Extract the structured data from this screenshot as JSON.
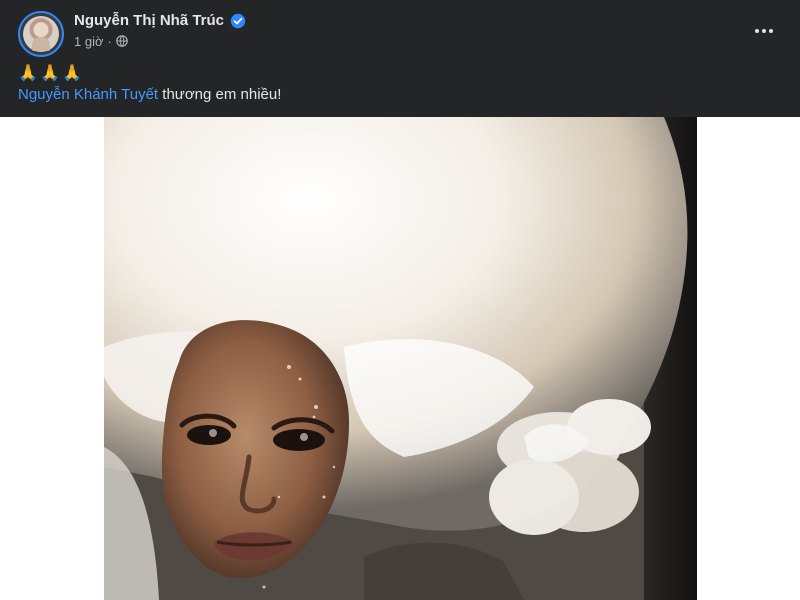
{
  "post": {
    "author_name": "Nguyễn Thị Nhã Trúc",
    "verified_icon": "verified-badge-icon",
    "timestamp": "1 giờ",
    "separator": "·",
    "privacy_icon": "globe-icon",
    "more_icon": "more-options-icon",
    "emoji_line": [
      "🙏",
      "🙏",
      "🙏"
    ],
    "mention": "Nguyễn Khánh Tuyết",
    "message_rest": " thương em nhiều!",
    "photo_icon": "post-photo"
  },
  "colors": {
    "header_bg": "#242526",
    "primary_text": "#e4e6eb",
    "secondary_text": "#b0b3b8",
    "link": "#4599ff",
    "verified": "#2d88ff"
  }
}
